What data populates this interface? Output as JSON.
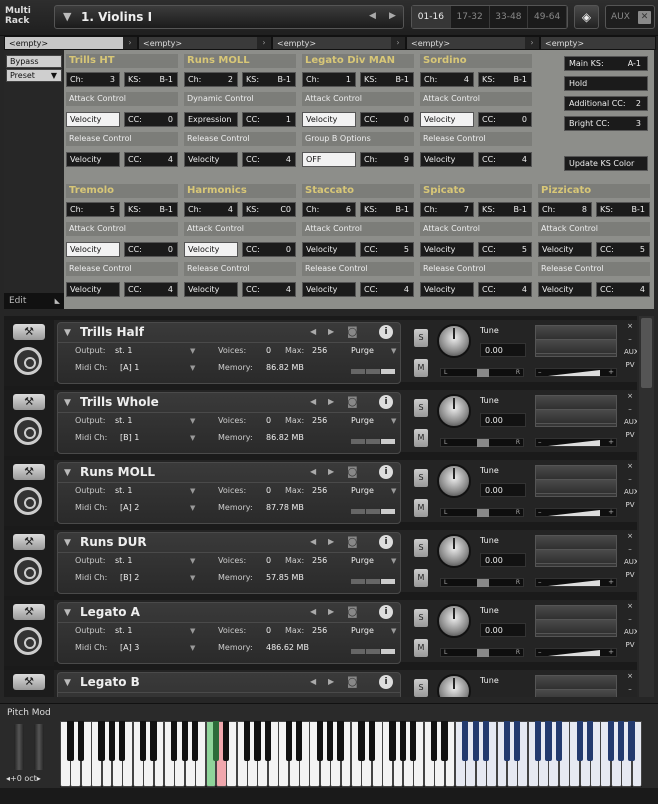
{
  "topbar": {
    "brand_line1": "Multi",
    "brand_line2": "Rack",
    "rack_name": "1. Violins I",
    "channel_tabs": [
      "01-16",
      "17-32",
      "33-48",
      "49-64"
    ],
    "aux_label": "AUX",
    "icons": [
      "triangle-down-icon",
      "arrow-left-icon",
      "arrow-right-icon",
      "keyboard-mode-icon",
      "close-icon"
    ]
  },
  "script_tabs": [
    "<empty>",
    "<empty>",
    "<empty>",
    "<empty>",
    "<empty>"
  ],
  "side": {
    "bypass": "Bypass",
    "preset": "Preset",
    "edit": "Edit"
  },
  "script_groups": [
    {
      "title": "Trills HT",
      "ch": "3",
      "ks": "B-1",
      "attack_label": "Attack Control",
      "attack_mode": "Velocity",
      "attack_cc": "0",
      "release_label": "Release Control",
      "release_mode": "Velocity",
      "release_cc": "4"
    },
    {
      "title": "Runs MOLL",
      "ch": "2",
      "ks": "B-1",
      "attack_label": "Dynamic Control",
      "attack_mode": "Expression",
      "attack_cc": "1",
      "release_label": "Release Control",
      "release_mode": "Velocity",
      "release_cc": "4"
    },
    {
      "title": "Legato Div MAN",
      "ch": "1",
      "ks": "B-1",
      "attack_label": "Attack Control",
      "attack_mode": "Velocity",
      "attack_cc": "0",
      "release_label": "Group B Options",
      "release_mode": "OFF",
      "release_cc_label": "Ch:",
      "release_cc": "9"
    },
    {
      "title": "Sordino",
      "ch": "4",
      "ks": "B-1",
      "attack_label": "Attack Control",
      "attack_mode": "Velocity",
      "attack_cc": "0",
      "release_label": "Release Control",
      "release_mode": "Velocity",
      "release_cc": "4"
    },
    {
      "title": "Tremolo",
      "ch": "5",
      "ks": "B-1",
      "attack_label": "Attack Control",
      "attack_mode": "Velocity",
      "attack_cc": "0",
      "release_label": "Release Control",
      "release_mode": "Velocity",
      "release_cc": "4"
    },
    {
      "title": "Harmonics",
      "ch": "4",
      "ks": "C0",
      "attack_label": "Attack Control",
      "attack_mode": "Velocity",
      "attack_cc": "0",
      "release_label": "Release Control",
      "release_mode": "Velocity",
      "release_cc": "4"
    },
    {
      "title": "Staccato",
      "ch": "6",
      "ks": "B-1",
      "attack_label": "Attack Control",
      "attack_mode": "Velocity",
      "attack_cc": "5",
      "release_label": "Release Control",
      "release_mode": "Velocity",
      "release_cc": "4"
    },
    {
      "title": "Spicato",
      "ch": "7",
      "ks": "B-1",
      "attack_label": "Attack Control",
      "attack_mode": "Velocity",
      "attack_cc": "5",
      "release_label": "Release Control",
      "release_mode": "Velocity",
      "release_cc": "4"
    },
    {
      "title": "Pizzicato",
      "ch": "8",
      "ks": "B-1",
      "attack_label": "Attack Control",
      "attack_mode": "Velocity",
      "attack_cc": "5",
      "release_label": "Release Control",
      "release_mode": "Velocity",
      "release_cc": "4"
    }
  ],
  "labels": {
    "ch": "Ch:",
    "ks": "KS:",
    "cc": "CC:"
  },
  "right_controls": {
    "main_ks_label": "Main KS:",
    "main_ks": "A-1",
    "hold": "Hold",
    "additional_cc_label": "Additional CC:",
    "additional_cc": "2",
    "bright_cc_label": "Bright CC:",
    "bright_cc": "3",
    "update_ks": "Update KS Color"
  },
  "instrument_labels": {
    "output": "Output:",
    "midi": "Midi Ch:",
    "voices": "Voices:",
    "max": "Max:",
    "memory": "Memory:",
    "tune": "Tune",
    "purge": "Purge",
    "s": "S",
    "m": "M",
    "pan_l": "L",
    "pan_r": "R",
    "aux": "AUX",
    "pv": "PV",
    "close": "×",
    "minimize": "–"
  },
  "instruments": [
    {
      "name": "Trills Half",
      "output": "st. 1",
      "midi": "[A] 1",
      "voices": "0",
      "max": "256",
      "memory": "86.82 MB",
      "tune": "0.00"
    },
    {
      "name": "Trills Whole",
      "output": "st. 1",
      "midi": "[B] 1",
      "voices": "0",
      "max": "256",
      "memory": "86.82 MB",
      "tune": "0.00"
    },
    {
      "name": "Runs MOLL",
      "output": "st. 1",
      "midi": "[A] 2",
      "voices": "0",
      "max": "256",
      "memory": "87.78 MB",
      "tune": "0.00"
    },
    {
      "name": "Runs DUR",
      "output": "st. 1",
      "midi": "[B] 2",
      "voices": "0",
      "max": "256",
      "memory": "57.85 MB",
      "tune": "0.00"
    },
    {
      "name": "Legato A",
      "output": "st. 1",
      "midi": "[A] 3",
      "voices": "0",
      "max": "256",
      "memory": "486.62 MB",
      "tune": "0.00"
    },
    {
      "name": "Legato B",
      "output": "",
      "midi": "",
      "voices": "",
      "max": "",
      "memory": "",
      "tune": ""
    }
  ],
  "keyboard": {
    "label": "Pitch Mod",
    "octave": "+0 oct",
    "white_key_count": 56,
    "highlight_start_white_index": 38,
    "green_white_index": 14,
    "pink_white_index": 15,
    "colors": {
      "keyswitch_blue": "#233a6e",
      "range_blue": "#e6e9f2",
      "green": "#8fd49a",
      "pink": "#f0a7ad"
    }
  }
}
